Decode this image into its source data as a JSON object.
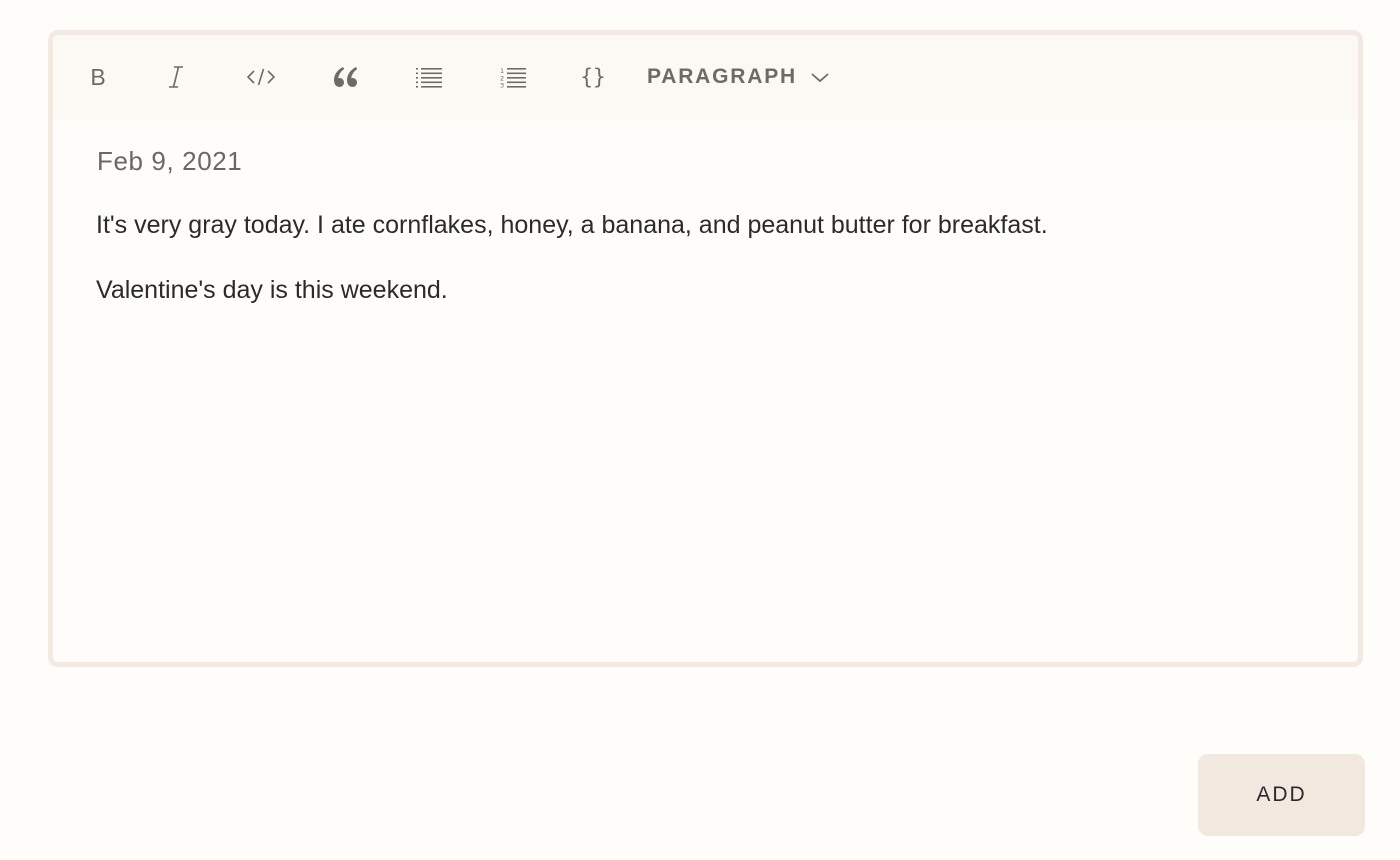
{
  "toolbar": {
    "buttons": [
      {
        "name": "bold",
        "icon": "bold-icon",
        "glyph": "B"
      },
      {
        "name": "italic",
        "icon": "italic-icon"
      },
      {
        "name": "inline-code",
        "icon": "code-icon"
      },
      {
        "name": "blockquote",
        "icon": "quote-icon"
      },
      {
        "name": "bulleted-list",
        "icon": "bulleted-list-icon"
      },
      {
        "name": "numbered-list",
        "icon": "numbered-list-icon"
      },
      {
        "name": "code-block",
        "icon": "braces-icon",
        "glyph": "{}"
      }
    ],
    "block_type": {
      "selected": "PARAGRAPH",
      "icon": "chevron-down-icon"
    }
  },
  "entry": {
    "date": "Feb 9, 2021",
    "paragraphs": [
      "It's very gray today. I ate cornflakes, honey, a banana, and peanut butter for breakfast.",
      "Valentine's day is this weekend."
    ]
  },
  "actions": {
    "add_label": "ADD"
  },
  "colors": {
    "background": "#fffdfa",
    "toolbar_bg": "#fcf8f4",
    "border": "#f4e9e1",
    "button_bg": "#f3e8df",
    "icon": "#6e6a66",
    "text": "#2b2b2b"
  }
}
